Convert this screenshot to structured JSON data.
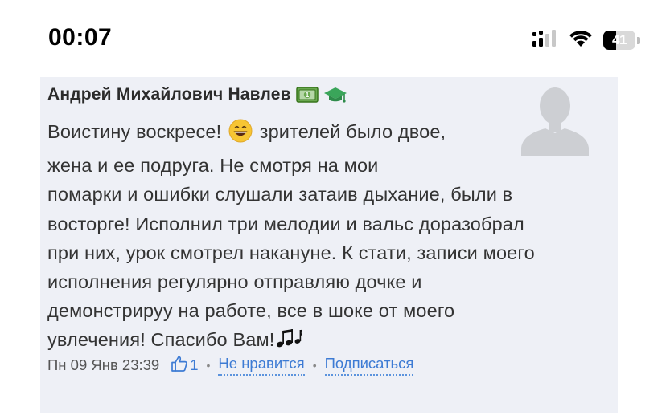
{
  "status_bar": {
    "time": "00:07",
    "battery_level": "41",
    "battery_fraction": 0.41,
    "icons": [
      "cellular-signal-icon",
      "wifi-icon",
      "battery-icon"
    ]
  },
  "comment": {
    "author": "Андрей Михайлович Навлев",
    "badges": [
      "money-badge-icon",
      "graduation-cap-icon"
    ],
    "text_lines": [
      "Воистину воскресе!",
      "зрителей было двое,",
      "жена и ее подруга. Не смотря на мои",
      "помарки и ошибки слушали затаив дыхание, были в",
      "восторге! Исполнил три мелодии и вальс доразобрал",
      "при них, урок смотрел накануне. К стати, записи моего",
      "исполнения регулярно отправляю дочке и",
      "демонстрируу на работе, все в шоке от моего",
      "увлечения! Спасибо Вам!"
    ],
    "date": "Пн 09 Янв 23:39",
    "like_count": "1",
    "dislike_label": "Не нравится",
    "subscribe_label": "Подписаться",
    "separator": "•",
    "colors": {
      "card_background": "#eef0f6",
      "link": "#3d7bd4",
      "text": "#333333"
    }
  }
}
